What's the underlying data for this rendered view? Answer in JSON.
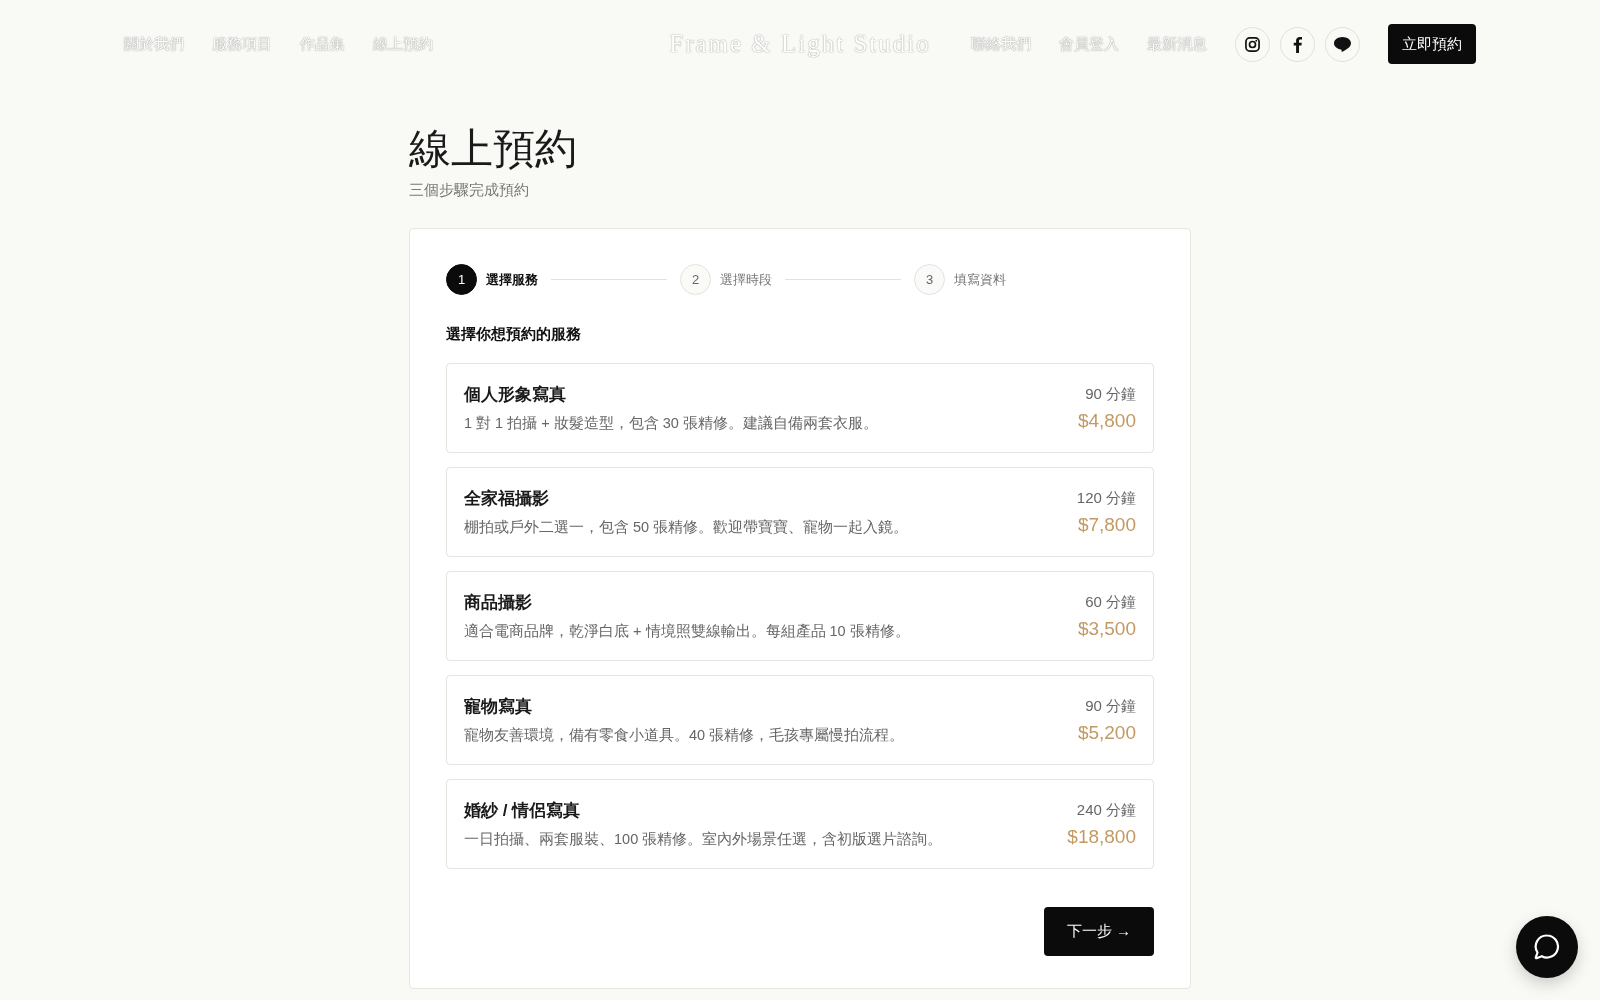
{
  "header": {
    "nav_left": [
      "關於我們",
      "服務項目",
      "作品集",
      "線上預約"
    ],
    "logo": "Frame & Light Studio",
    "nav_right": [
      "聯絡我們",
      "會員登入",
      "最新消息"
    ],
    "cta": "立即預約"
  },
  "page": {
    "title": "線上預約",
    "subtitle": "三個步驟完成預約"
  },
  "stepper": [
    {
      "number": "1",
      "label": "選擇服務",
      "selected": true
    },
    {
      "number": "2",
      "label": "選擇時段",
      "selected": false
    },
    {
      "number": "3",
      "label": "填寫資料",
      "selected": false
    }
  ],
  "section_title": "選擇你想預約的服務",
  "services": [
    {
      "name": "個人形象寫真",
      "description": "1 對 1 拍攝 + 妝髮造型，包含 30 張精修。建議自備兩套衣服。",
      "duration": "90 分鐘",
      "price": "$4,800",
      "selected": false
    },
    {
      "name": "全家福攝影",
      "description": "棚拍或戶外二選一，包含 50 張精修。歡迎帶寶寶、寵物一起入鏡。",
      "duration": "120 分鐘",
      "price": "$7,800",
      "selected": false
    },
    {
      "name": "商品攝影",
      "description": "適合電商品牌，乾淨白底 + 情境照雙線輸出。每組產品 10 張精修。",
      "duration": "60 分鐘",
      "price": "$3,500",
      "selected": false
    },
    {
      "name": "寵物寫真",
      "description": "寵物友善環境，備有零食小道具。40 張精修，毛孩專屬慢拍流程。",
      "duration": "90 分鐘",
      "price": "$5,200",
      "selected": false
    },
    {
      "name": "婚紗 / 情侶寫真",
      "description": "一日拍攝、兩套服裝、100 張精修。室內外場景任選，含初版選片諮詢。",
      "duration": "240 分鐘",
      "price": "$18,800",
      "selected": false
    }
  ],
  "next_button": "下一步 →"
}
